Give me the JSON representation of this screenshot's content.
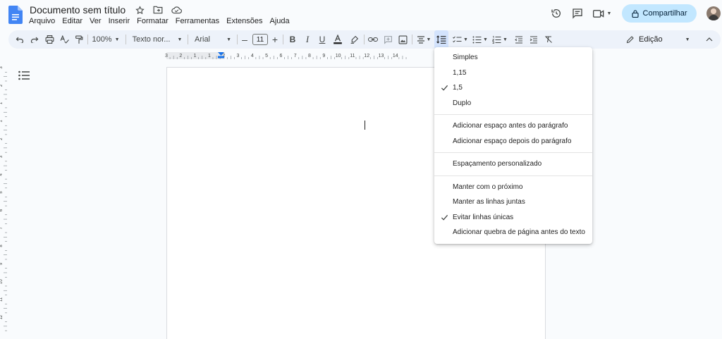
{
  "header": {
    "title": "Documento sem título",
    "menu": [
      "Arquivo",
      "Editar",
      "Ver",
      "Inserir",
      "Formatar",
      "Ferramentas",
      "Extensões",
      "Ajuda"
    ],
    "share_label": "Compartilhar"
  },
  "toolbar": {
    "zoom": "100%",
    "style": "Texto nor...",
    "font": "Arial",
    "font_size": "11",
    "mode": "Edição"
  },
  "ruler": {
    "top_labels": [
      "3",
      "2",
      "1",
      "1",
      "2",
      "3",
      "4",
      "5",
      "6",
      "7",
      "8",
      "9",
      "10",
      "11",
      "12",
      "13",
      "14"
    ],
    "left_labels": [
      "3",
      "2",
      "1",
      "1",
      "2",
      "3",
      "4",
      "5",
      "6",
      "7",
      "8",
      "9",
      "10",
      "11",
      "12"
    ]
  },
  "line_spacing_menu": {
    "spacing": [
      {
        "label": "Simples",
        "checked": false
      },
      {
        "label": "1,15",
        "checked": false
      },
      {
        "label": "1,5",
        "checked": true
      },
      {
        "label": "Duplo",
        "checked": false
      }
    ],
    "paragraph": [
      {
        "label": "Adicionar espaço antes do parágrafo",
        "checked": false
      },
      {
        "label": "Adicionar espaço depois do parágrafo",
        "checked": false
      }
    ],
    "custom": [
      {
        "label": "Espaçamento personalizado",
        "checked": false
      }
    ],
    "pagination": [
      {
        "label": "Manter com o próximo",
        "checked": false
      },
      {
        "label": "Manter as linhas juntas",
        "checked": false
      },
      {
        "label": "Evitar linhas únicas",
        "checked": true
      },
      {
        "label": "Adicionar quebra de página antes do texto",
        "checked": false
      }
    ]
  },
  "colors": {
    "accent": "#0b57d0",
    "share_bg": "#c2e7ff",
    "toolbar_bg": "#edf2fa"
  }
}
